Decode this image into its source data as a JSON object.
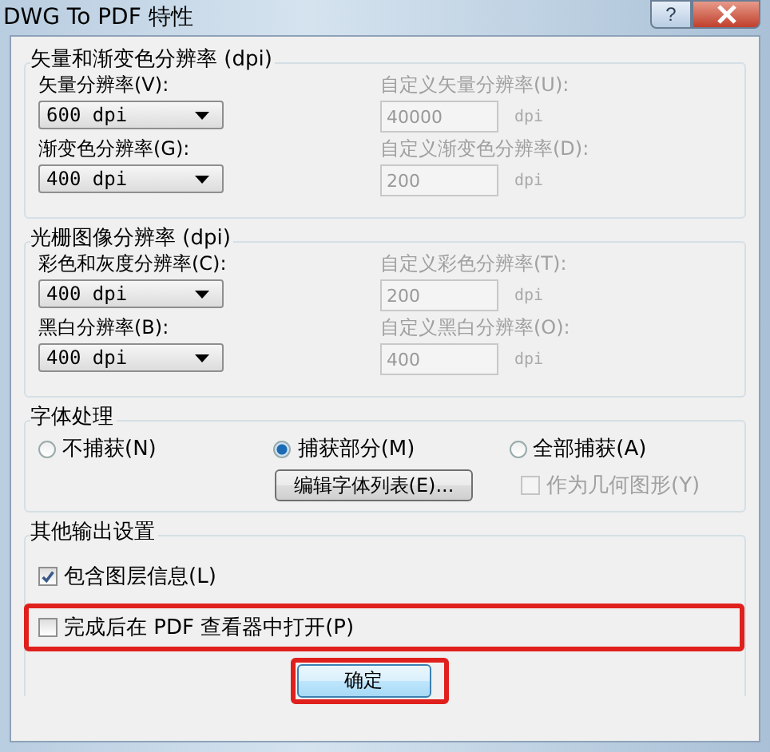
{
  "window": {
    "title": "DWG To PDF 特性",
    "help": "?"
  },
  "resolution_groups": [
    {
      "title": "矢量和渐变色分辨率 (dpi)",
      "rows": [
        {
          "label": "矢量分辨率(V):",
          "value": "600 dpi",
          "custom_label": "自定义矢量分辨率(U):",
          "custom_value": "40000",
          "unit": "dpi"
        },
        {
          "label": "渐变色分辨率(G):",
          "value": "400 dpi",
          "custom_label": "自定义渐变色分辨率(D):",
          "custom_value": "200",
          "unit": "dpi"
        }
      ]
    },
    {
      "title": "光栅图像分辨率 (dpi)",
      "rows": [
        {
          "label": "彩色和灰度分辨率(C):",
          "value": "400 dpi",
          "custom_label": "自定义彩色分辨率(T):",
          "custom_value": "200",
          "unit": "dpi"
        },
        {
          "label": "黑白分辨率(B):",
          "value": "400 dpi",
          "custom_label": "自定义黑白分辨率(O):",
          "custom_value": "400",
          "unit": "dpi"
        }
      ]
    }
  ],
  "font_group": {
    "title": "字体处理",
    "radios": [
      {
        "label": "不捕获(N)",
        "selected": false
      },
      {
        "label": "捕获部分(M)",
        "selected": true
      },
      {
        "label": "全部捕获(A)",
        "selected": false
      }
    ],
    "edit_button": "编辑字体列表(E)...",
    "geometry_checkbox": {
      "label": "作为几何图形(Y)",
      "checked": false,
      "disabled": true
    }
  },
  "output_group": {
    "title": "其他输出设置",
    "checkboxes": [
      {
        "label": "包含图层信息(L)",
        "checked": true,
        "highlighted": false
      },
      {
        "label": "完成后在 PDF 查看器中打开(P)",
        "checked": false,
        "highlighted": true
      }
    ]
  },
  "buttons": [
    {
      "label": "确定",
      "highlighted": true
    }
  ]
}
